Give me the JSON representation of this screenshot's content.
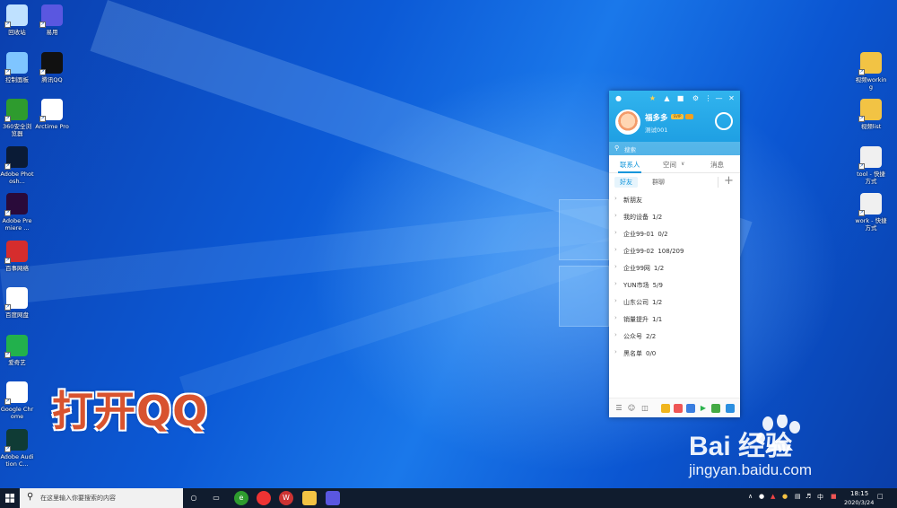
{
  "desktop_icons_left": [
    {
      "label": "回收站",
      "icon": "recycle-bin-icon",
      "color": "#bfe1ff"
    },
    {
      "label": "控制面板",
      "icon": "control-panel-icon",
      "color": "#7fc5ff"
    },
    {
      "label": "360安全浏览器",
      "icon": "browser-360-icon",
      "color": "#2e9b2e"
    },
    {
      "label": "Adobe Photosh...",
      "icon": "photoshop-icon",
      "color": "#0a1b36"
    },
    {
      "label": "Adobe Premiere ...",
      "icon": "premiere-icon",
      "color": "#2a0a3a"
    },
    {
      "label": "百事网络",
      "icon": "pepsi-icon",
      "color": "#d62d2d"
    },
    {
      "label": "百度网盘",
      "icon": "baidu-netdisk-icon",
      "color": "#ffffff"
    },
    {
      "label": "爱奇艺",
      "icon": "iqiyi-icon",
      "color": "#22b14c"
    },
    {
      "label": "Google Chrome",
      "icon": "chrome-icon",
      "color": "#ffffff"
    },
    {
      "label": "Adobe Audition C...",
      "icon": "audition-icon",
      "color": "#0f3b35"
    }
  ],
  "desktop_icons_left2": [
    {
      "label": "易用",
      "icon": "app-purple-icon",
      "color": "#5a57e0"
    },
    {
      "label": "腾讯QQ",
      "icon": "qq-penguin-icon",
      "color": "#111111"
    },
    {
      "label": "Arctime Pro",
      "icon": "arctime-icon",
      "color": "#ffffff"
    }
  ],
  "desktop_icons_right": [
    {
      "label": "视频working",
      "icon": "folder-icon"
    },
    {
      "label": "视频list",
      "icon": "folder-icon"
    },
    {
      "label": "tool - 快捷方式",
      "icon": "file-shortcut-icon"
    },
    {
      "label": "work - 快捷方式",
      "icon": "file-shortcut-icon"
    }
  ],
  "overlay_title": "打开QQ",
  "qq": {
    "nickname": "福多多",
    "vip_badge": "SVIP",
    "signature": "测试001",
    "search_placeholder": "搜索",
    "tabs": [
      "联系人",
      "空间",
      "消息"
    ],
    "active_tab": "联系人",
    "sub_tabs": [
      "好友",
      "群聊"
    ],
    "groups": [
      {
        "name": "新朋友",
        "count": ""
      },
      {
        "name": "我的设备",
        "count": "1/2"
      },
      {
        "name": "企业99-01",
        "count": "0/2"
      },
      {
        "name": "企业99-02",
        "count": "108/209"
      },
      {
        "name": "企业99网",
        "count": "1/2"
      },
      {
        "name": "YUN市场",
        "count": "5/9"
      },
      {
        "name": "山东公司",
        "count": "1/2"
      },
      {
        "name": "销量提升",
        "count": "1/1"
      },
      {
        "name": "公众号",
        "count": "2/2"
      },
      {
        "name": "黑名单",
        "count": "0/0"
      }
    ]
  },
  "taskbar": {
    "search_placeholder": "在这里输入你要搜索的内容",
    "ime_label": "中",
    "time": "18:15",
    "date": "2020/3/24"
  },
  "watermark": {
    "logo": "Bai  经验",
    "url": "jingyan.baidu.com"
  },
  "colors": {
    "qq_blue": "#1a9ae0",
    "overlay_text": "#d8532f",
    "taskbar": "#101c2e"
  }
}
